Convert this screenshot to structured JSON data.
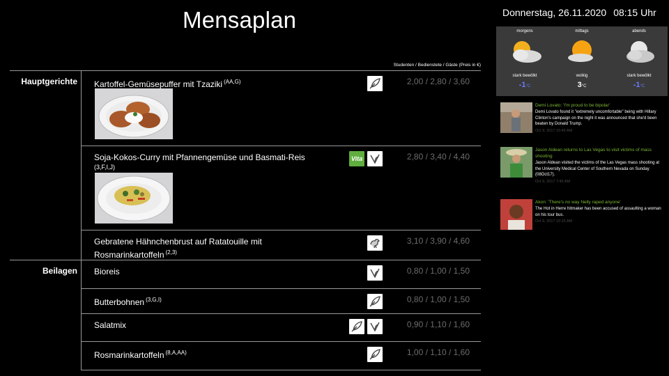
{
  "header": {
    "title": "Mensaplan",
    "date": "Donnerstag, 26.11.2020",
    "time": "08:15 Uhr"
  },
  "price_caption": "Studenten / Bedienstete / Gäste (Preis in €)",
  "sections": [
    {
      "label": "Hauptgerichte",
      "dishes": [
        {
          "name": "Kartoffel-Gemüsepuffer mit Tzaziki",
          "allergens": "(AA,G)",
          "price": "2,00 / 2,80 / 3,60",
          "icons": [
            "vegetarian-icon"
          ]
        },
        {
          "name": "Soja-Kokos-Curry mit Pfannengemüse und Basmati-Reis",
          "allergens": "(3,F,I,J)",
          "price": "2,80 / 3,40 / 4,40",
          "icons": [
            "vital-icon",
            "vegan-icon"
          ],
          "vital_label": "Vita"
        },
        {
          "name": "Gebratene Hähnchenbrust auf Ratatouille mit",
          "name_line2": "Rosmarinkartoffeln",
          "allergens": "(2,3)",
          "price": "3,10 / 3,90 / 4,60",
          "icons": [
            "chicken-icon"
          ]
        }
      ]
    },
    {
      "label": "Beilagen",
      "dishes": [
        {
          "name": "Bioreis",
          "allergens": "",
          "price": "0,80 / 1,00 / 1,50",
          "icons": [
            "vegan-icon"
          ]
        },
        {
          "name": "Butterbohnen",
          "allergens": "(3,G,I)",
          "price": "0,80 / 1,00 / 1,50",
          "icons": [
            "vegetarian-icon"
          ]
        },
        {
          "name": "Salatmix",
          "allergens": "",
          "price": "0,90 / 1,10 / 1,60",
          "icons": [
            "vegetarian-icon",
            "vegan-icon"
          ]
        },
        {
          "name": "Rosmarinkartoffeln",
          "allergens": "(8,A,AA)",
          "price": "1,00 / 1,10 / 1,60",
          "icons": [
            "vegetarian-icon"
          ]
        }
      ]
    }
  ],
  "weather": [
    {
      "period": "morgens",
      "condition": "stark bewölkt",
      "temp": "-1",
      "unit": "°C",
      "temp_color": "#6a7cff",
      "icon": "cloudy-sun-icon"
    },
    {
      "period": "mittags",
      "condition": "wolkig",
      "temp": "3",
      "unit": "°C",
      "temp_color": "#ffffff",
      "icon": "partly-cloudy-icon"
    },
    {
      "period": "abends",
      "condition": "stark bewölkt",
      "temp": "-1",
      "unit": "°C",
      "temp_color": "#6a7cff",
      "icon": "cloudy-moon-icon"
    }
  ],
  "news": [
    {
      "headline": "Demi Lovato: 'I'm proud to be bipolar'",
      "body": "Demi Lovato found it \"extremely uncomfortable\" being with Hillary Clinton's campaign on the night it was announced that she'd been beaten by Donald Trump.",
      "date": "Oct 9, 2017 10:45 AM"
    },
    {
      "headline": "Jason Aldean returns to Las Vegas to visit victims of mass shooting",
      "body": "Jason Aldean visited the victims of the Las Vegas mass shooting at the University Medical Center of Southern Nevada on Sunday (08Oct17).",
      "date": "Oct 9, 2017 7:45 AM"
    },
    {
      "headline": "Akon: 'There's no way Nelly raped anyone'",
      "body": "The Hot in Herre hitmaker has been accused of assaulting a woman on his tour bus.",
      "date": "Oct 9, 2017 10:15 AM"
    }
  ],
  "colors": {
    "news_headline": "#7db734",
    "price": "#6c6c6c",
    "weather_bg": "#3a3a3a",
    "rule": "#9a9a9a"
  }
}
